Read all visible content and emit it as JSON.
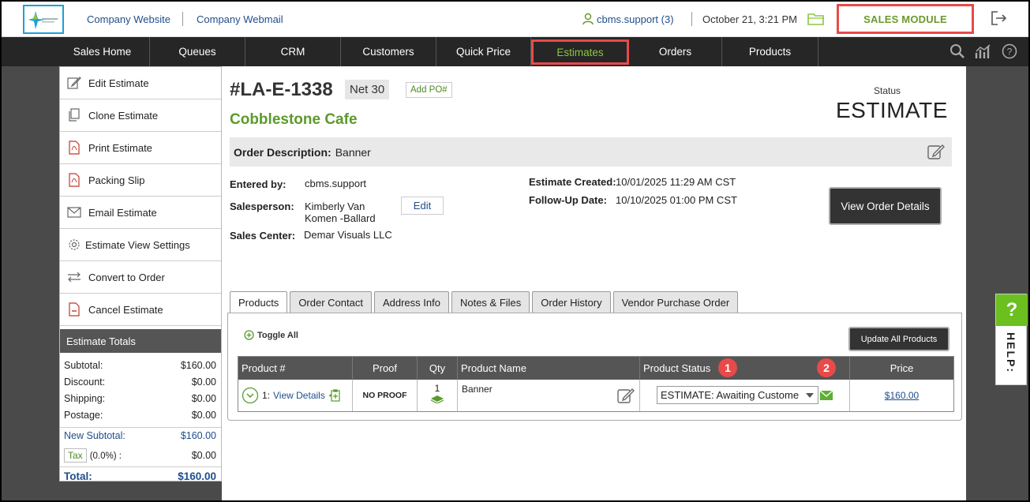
{
  "topbar": {
    "company_website": "Company Website",
    "company_webmail": "Company Webmail",
    "user": "cbms.support (3)",
    "datetime": "October 21, 3:21 PM",
    "module": "SALES MODULE"
  },
  "nav": [
    "Sales Home",
    "Queues",
    "CRM",
    "Customers",
    "Quick Price",
    "Estimates",
    "Orders",
    "Products"
  ],
  "sidebar": {
    "items": [
      "Edit Estimate",
      "Clone Estimate",
      "Print Estimate",
      "Packing Slip",
      "Email Estimate",
      "Estimate View Settings",
      "Convert to Order",
      "Cancel Estimate"
    ],
    "totals_title": "Estimate Totals",
    "subtotal_label": "Subtotal:",
    "subtotal": "$160.00",
    "discount_label": "Discount:",
    "discount": "$0.00",
    "shipping_label": "Shipping:",
    "shipping": "$0.00",
    "postage_label": "Postage:",
    "postage": "$0.00",
    "new_subtotal_label": "New Subtotal:",
    "new_subtotal": "$160.00",
    "tax_label": "Tax",
    "tax_rate": "(0.0%) :",
    "tax": "$0.00",
    "total_label": "Total:",
    "total": "$160.00"
  },
  "estimate": {
    "number": "#LA-E-1338",
    "terms": "Net 30",
    "add_po": "Add PO#",
    "status_label": "Status",
    "status": "ESTIMATE",
    "customer": "Cobblestone Cafe",
    "description_label": "Order Description:",
    "description": "Banner",
    "entered_by_label": "Entered by:",
    "entered_by": "cbms.support",
    "salesperson_label": "Salesperson:",
    "salesperson_line1": "Kimberly Van",
    "salesperson_line2": "Komen -Ballard",
    "edit": "Edit",
    "sales_center_label": "Sales Center:",
    "sales_center": "Demar Visuals LLC",
    "created_label": "Estimate Created:",
    "created": "10/01/2025 11:29 AM CST",
    "followup_label": "Follow-Up Date:",
    "followup": "10/10/2025 01:00 PM CST",
    "view_order_details": "View Order Details"
  },
  "tabs": [
    "Products",
    "Order Contact",
    "Address Info",
    "Notes & Files",
    "Order History",
    "Vendor Purchase Order"
  ],
  "products": {
    "toggle_all": "Toggle All",
    "update_all": "Update All Products",
    "headers": [
      "Product #",
      "Proof",
      "Qty",
      "Product Name",
      "Product Status",
      "Price"
    ],
    "badge1": "1",
    "badge2": "2",
    "row": {
      "num": "1:",
      "view_details": "View Details",
      "proof": "NO PROOF",
      "qty": "1",
      "name": "Banner",
      "status": "ESTIMATE: Awaiting Custome",
      "price": "$160.00"
    }
  },
  "help": {
    "q": "?",
    "label": "HELP:"
  }
}
